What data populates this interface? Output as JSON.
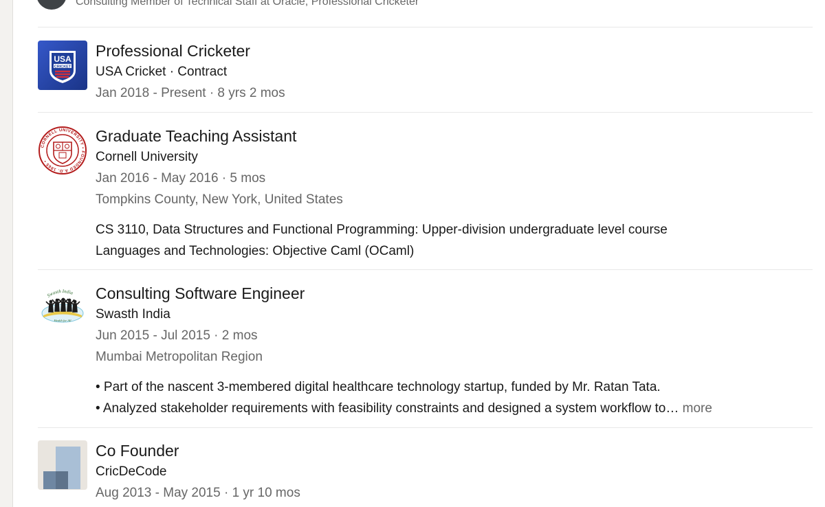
{
  "profile": {
    "headline": "Consulting Member of Technical Staff at Oracle, Professional Cricketer"
  },
  "experience": [
    {
      "title": "Professional Cricketer",
      "company_line": "USA Cricket · Contract",
      "dates": "Jan 2018 - Present · 8 yrs 2 mos",
      "logo_icon": "usa-cricket-logo",
      "logo_text": "USA CRICKET"
    },
    {
      "title": "Graduate Teaching Assistant",
      "company_line": "Cornell University",
      "dates": "Jan 2016 - May 2016 · 5 mos",
      "location": "Tompkins County, New York, United States",
      "description": [
        "CS 3110, Data Structures and Functional Programming: Upper-division undergraduate level course",
        "Languages and Technologies: Objective Caml (OCaml)"
      ],
      "logo_icon": "cornell-university-seal",
      "logo_text": "CORNELL UNIVERSITY FOUNDED A.D. 1865"
    },
    {
      "title": "Consulting Software Engineer",
      "company_line": "Swasth India",
      "dates": "Jun 2015 - Jul 2015 · 2 mos",
      "location": "Mumbai Metropolitan Region",
      "description": [
        "• Part of the nascent 3-membered digital healthcare technology startup, funded by Mr. Ratan Tata.",
        "• Analyzed stakeholder requirements with feasibility constraints and designed a system workflow to…"
      ],
      "more_label": "more",
      "logo_icon": "swasth-india-logo",
      "logo_text": "Swasth India Health for All"
    },
    {
      "title": "Co Founder",
      "company_line": "CricDeCode",
      "dates": "Aug 2013 - May 2015 · 1 yr 10 mos",
      "logo_icon": "company-placeholder-logo"
    }
  ],
  "colors": {
    "usa_blue": "#1f3f9a",
    "cornell_red": "#b31b1b",
    "secondary_text": "#666666",
    "placeholder_logo_bg": "#e9e5df",
    "placeholder_logo_block": "#a9bfd6"
  }
}
